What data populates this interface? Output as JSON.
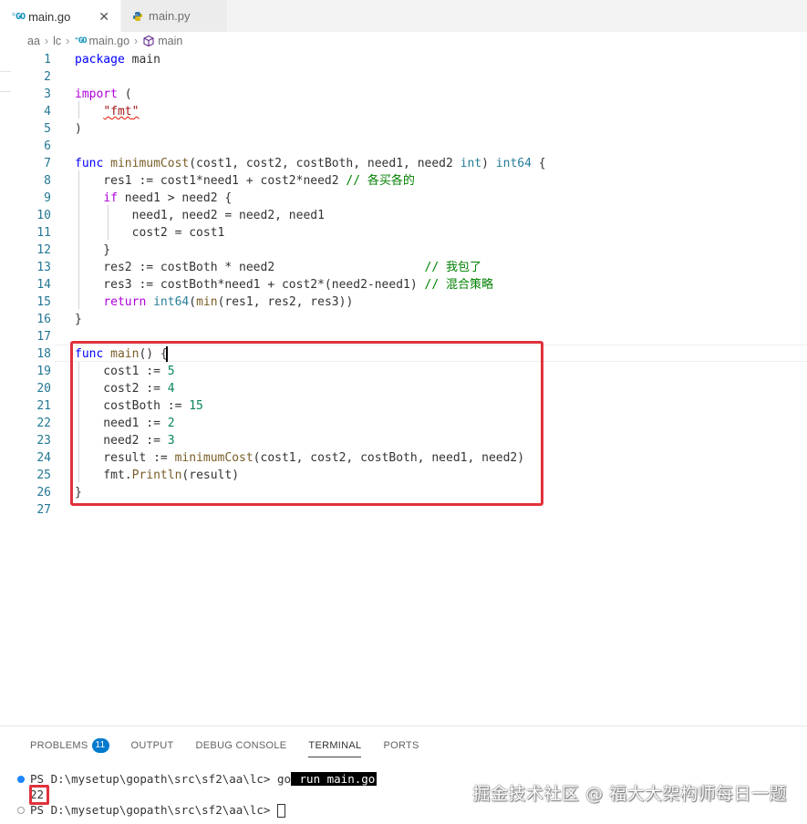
{
  "tabs": [
    {
      "icon": "go-file-icon",
      "label": "main.go",
      "active": true
    },
    {
      "icon": "python-file-icon",
      "label": "main.py",
      "active": false
    }
  ],
  "breadcrumb": [
    "aa",
    "lc",
    "main.go",
    "main"
  ],
  "editor": {
    "lines": [
      {
        "n": "1"
      },
      {
        "n": "2"
      },
      {
        "n": "3"
      },
      {
        "n": "4"
      },
      {
        "n": "5"
      },
      {
        "n": "6"
      },
      {
        "n": "7"
      },
      {
        "n": "8"
      },
      {
        "n": "9"
      },
      {
        "n": "10"
      },
      {
        "n": "11"
      },
      {
        "n": "12"
      },
      {
        "n": "13"
      },
      {
        "n": "14"
      },
      {
        "n": "15"
      },
      {
        "n": "16"
      },
      {
        "n": "17"
      },
      {
        "n": "18"
      },
      {
        "n": "19"
      },
      {
        "n": "20"
      },
      {
        "n": "21"
      },
      {
        "n": "22"
      },
      {
        "n": "23"
      },
      {
        "n": "24"
      },
      {
        "n": "25"
      },
      {
        "n": "26"
      },
      {
        "n": "27"
      }
    ],
    "tokens": {
      "package": "package",
      "main_name": " main",
      "import": "import",
      "open_paren": " (",
      "quote": "\"",
      "fmt": "fmt",
      "close_paren": ")",
      "func": "func",
      "minimumCost": "minimumCost",
      "params": "(cost1, cost2, costBoth, need1, need2 ",
      "int": "int",
      "params_close": ") ",
      "int64": "int64",
      "brace_open": " {",
      "l8": "    res1 := cost1*need1 + cost2*need2 ",
      "c8": "// 各买各的",
      "if": "if",
      "l9": " need1 > need2 {",
      "l10": "        need1, need2 = need2, need1",
      "l11": "        cost2 = cost1",
      "l12": "    }",
      "l13": "    res2 := costBoth * need2                     ",
      "c13": "// 我包了",
      "l14": "    res3 := costBoth*need1 + cost2*(need2-need1) ",
      "c14": "// 混合策略",
      "return": "return",
      "l15_int64": "int64",
      "l15_open": "(",
      "min": "min",
      "l15_args": "(res1, res2, res3))",
      "brace_close": "}",
      "main_fn": "main",
      "main_sig": "() {",
      "l19": "    cost1 := ",
      "v19": "5",
      "l20": "    cost2 := ",
      "v20": "4",
      "l21": "    costBoth := ",
      "v21": "15",
      "l22": "    need1 := ",
      "v22": "2",
      "l23": "    need2 := ",
      "v23": "3",
      "l24a": "    result := ",
      "l24_fn": "minimumCost",
      "l24b": "(cost1, cost2, costBoth, need1, need2)",
      "l25a": "    fmt.",
      "println": "Println",
      "l25b": "(result)"
    }
  },
  "panel": {
    "tabs": [
      "PROBLEMS",
      "OUTPUT",
      "DEBUG CONSOLE",
      "TERMINAL",
      "PORTS"
    ],
    "problems_count": "11",
    "active_tab": "TERMINAL"
  },
  "terminal": {
    "prompt1": "PS D:\\mysetup\\gopath\\src\\sf2\\aa\\lc> ",
    "cmd_go": "go",
    "cmd_rest": " run main.go",
    "output": "22",
    "prompt2": "PS D:\\mysetup\\gopath\\src\\sf2\\aa\\lc> "
  },
  "watermark": "掘金技术社区 @ 福大大架构师每日一题",
  "colors": {
    "highlight_box": "#e0313c",
    "keyword": "#0000ff",
    "control": "#af00db",
    "function": "#795e26",
    "type": "#267f99",
    "comment": "#008000",
    "number": "#098658",
    "string": "#a31515",
    "line_number": "#237893"
  }
}
